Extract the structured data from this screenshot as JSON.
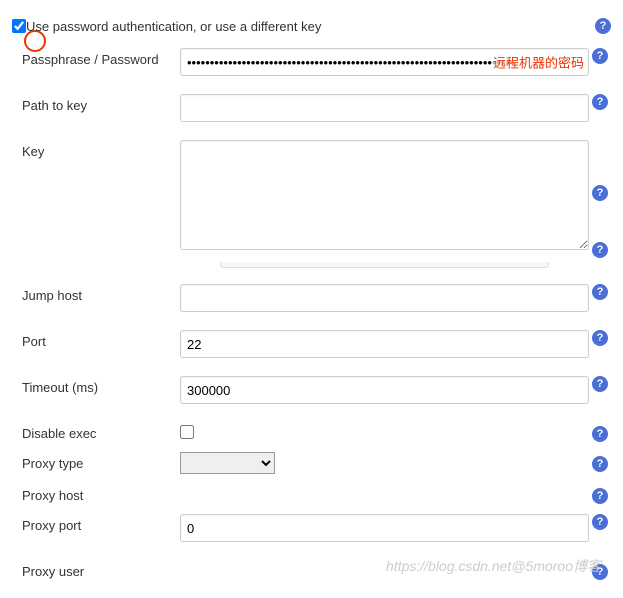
{
  "top": {
    "checkbox_checked": true,
    "label": "Use password authentication, or use a different key"
  },
  "fields": {
    "passphrase": {
      "label": "Passphrase / Password",
      "value": "••••••••••••••••••••••••••••••••••••••••••••••••••••••••••••••••••••••••",
      "annotation": "远程机器的密码"
    },
    "path_to_key": {
      "label": "Path to key",
      "value": ""
    },
    "key": {
      "label": "Key",
      "value": ""
    },
    "jump_host": {
      "label": "Jump host",
      "value": ""
    },
    "port": {
      "label": "Port",
      "value": "22"
    },
    "timeout": {
      "label": "Timeout (ms)",
      "value": "300000"
    },
    "disable_exec": {
      "label": "Disable exec",
      "checked": false
    },
    "proxy_type": {
      "label": "Proxy type",
      "value": ""
    },
    "proxy_host": {
      "label": "Proxy host",
      "value": ""
    },
    "proxy_port": {
      "label": "Proxy port",
      "value": "0"
    },
    "proxy_user": {
      "label": "Proxy user",
      "value": ""
    }
  },
  "watermark": "https://blog.csdn.net@5moroo博客"
}
